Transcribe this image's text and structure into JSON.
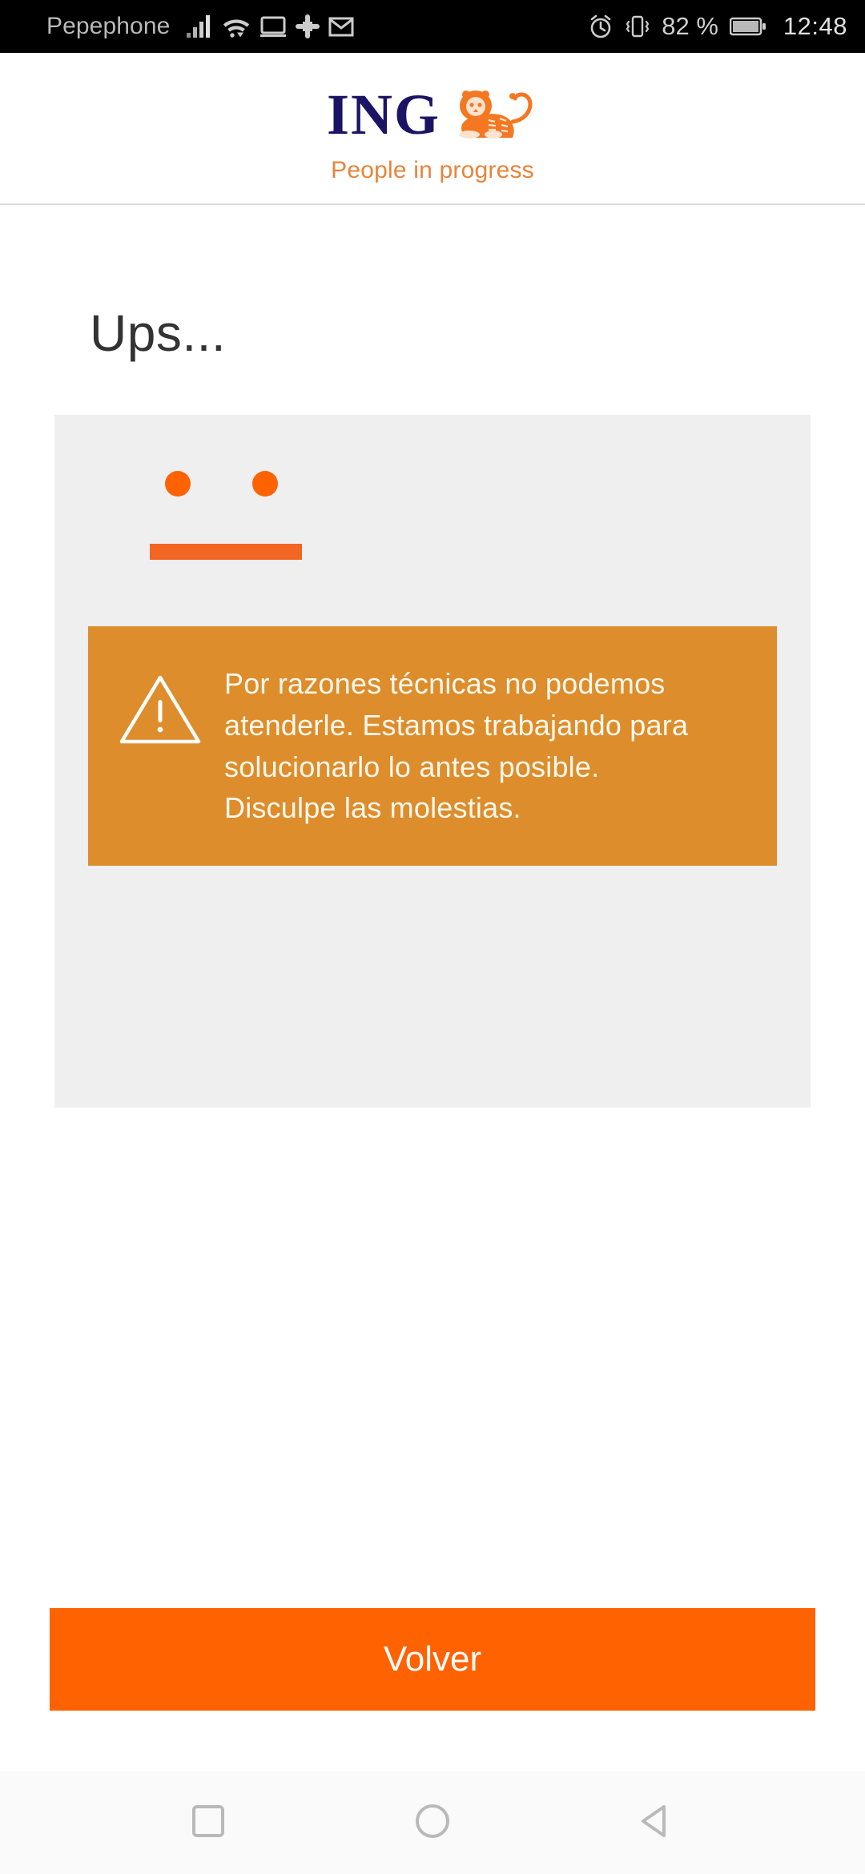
{
  "status_bar": {
    "carrier": "Pepephone",
    "icons_left": [
      "signal-icon",
      "wifi-icon",
      "cast-screen-icon",
      "slack-icon",
      "gmail-icon"
    ],
    "icons_right": [
      "alarm-icon",
      "vibrate-icon",
      "battery-icon"
    ],
    "battery_percent": "82 %",
    "time": "12:48"
  },
  "header": {
    "brand": "ING",
    "tagline": "People in progress",
    "logo_icon": "ing-lion-icon",
    "brand_color": "#1b1464",
    "accent_color": "#ff6200"
  },
  "main": {
    "title": "Ups...",
    "face": {
      "eye_left_icon": "face-eye-left-icon",
      "eye_right_icon": "face-eye-right-icon",
      "mouth_icon": "face-mouth-icon",
      "color": "#ff6200"
    },
    "alert": {
      "icon": "warning-triangle-icon",
      "message": "Por razones técnicas no podemos atenderle. Estamos trabajando para solucionarlo lo antes posible. Disculpe las molestias.",
      "background_color": "#dd8d2b",
      "text_color": "#fdf8ee"
    }
  },
  "footer": {
    "back_button_label": "Volver",
    "back_button_color": "#ff6200"
  },
  "nav_bar": {
    "recents_icon": "square-recents-icon",
    "home_icon": "circle-home-icon",
    "back_icon": "triangle-back-icon"
  }
}
